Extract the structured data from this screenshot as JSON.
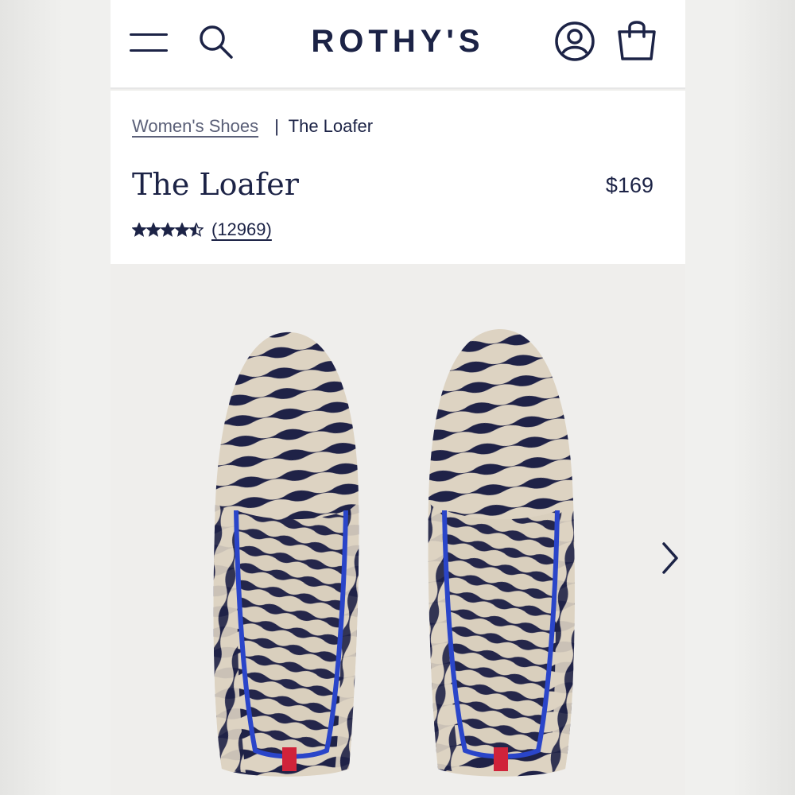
{
  "header": {
    "brand": "ROTHY'S",
    "icons": [
      "menu-icon",
      "search-icon",
      "account-icon",
      "shopping-bag-icon"
    ]
  },
  "breadcrumb": {
    "parent": "Women's Shoes",
    "separator": "|",
    "current": "The Loafer"
  },
  "product": {
    "title": "The Loafer",
    "price": "$169",
    "rating": 4.5,
    "rating_max": 5,
    "review_count": "(12969)"
  },
  "gallery": {
    "image": "zebra-print knit loafers, top view",
    "next_icon": "chevron-right-icon"
  },
  "colors": {
    "navy": "#1c2346",
    "link_gray": "#5b6078",
    "background": "#efeeec",
    "lining_blue": "#2a45c9",
    "heel_red": "#d0233a",
    "knit_cream": "#ddd3c2"
  }
}
